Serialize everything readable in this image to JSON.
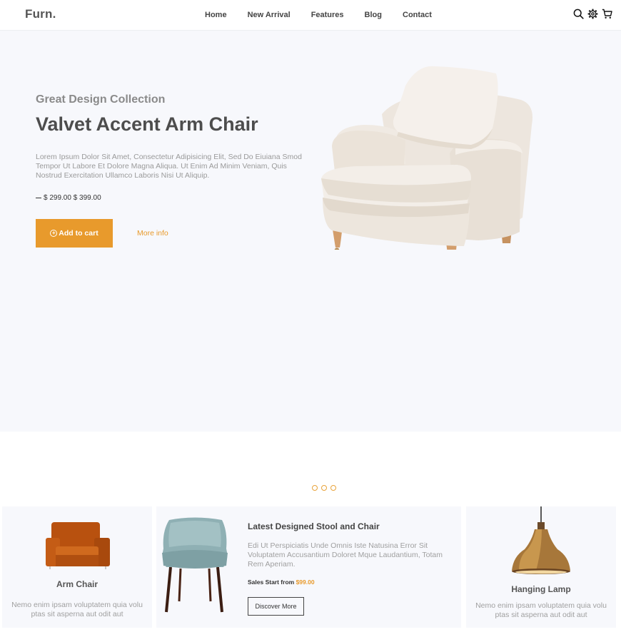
{
  "header": {
    "logo": "Furn.",
    "nav": [
      "Home",
      "New Arrival",
      "Features",
      "Blog",
      "Contact"
    ],
    "icons": [
      "search-icon",
      "settings-icon",
      "cart-icon"
    ]
  },
  "hero": {
    "subtitle": "Great Design Collection",
    "title": "Valvet Accent Arm Chair",
    "description": "Lorem Ipsum Dolor Sit Amet, Consectetur Adipisicing Elit, Sed Do Eiuiana Smod Tempor Ut Labore Et Dolore Magna Aliqua. Ut Enim Ad Minim Veniam, Quis Nostrud Exercitation Ullamco Laboris Nisi Ut Aliquip.",
    "price": "$ 299.00 $ 399.00",
    "add_to_cart": "Add to cart",
    "more_info": "More info"
  },
  "cards": {
    "arm_chair": {
      "title": "Arm Chair",
      "text": "Nemo enim ipsam voluptatem quia volu ptas sit asperna aut odit aut"
    },
    "featured": {
      "title": "Latest Designed Stool and Chair",
      "text": "Edi Ut Perspiciatis Unde Omnis Iste Natusina Error Sit Voluptatem Accusantium Doloret Mque Laudantium, Totam Rem Aperiam.",
      "sales_label": "Sales Start from",
      "sales_price": "$99.00",
      "button": "Discover More"
    },
    "lamp": {
      "title": "Hanging Lamp",
      "text": "Nemo enim ipsam voluptatem quia volu ptas sit asperna aut odit aut"
    }
  },
  "colors": {
    "accent": "#e89a2c",
    "hero_bg": "#f7f8fc"
  }
}
